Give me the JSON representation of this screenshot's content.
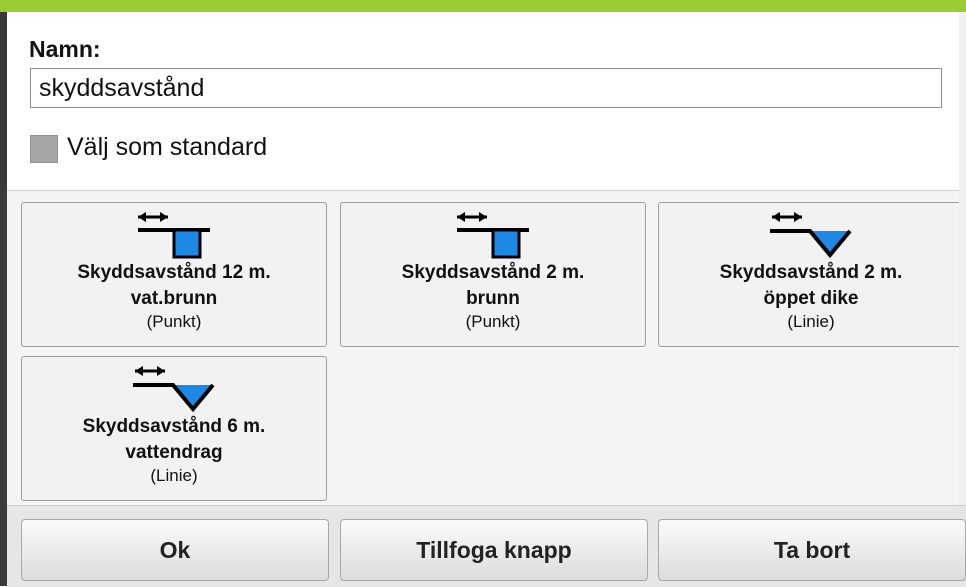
{
  "form": {
    "name_label": "Namn:",
    "name_value": "skyddsavstånd",
    "default_checkbox_label": "Välj som standard",
    "default_checked": false
  },
  "tiles": [
    {
      "title_line1": "Skyddsavstånd 12 m.",
      "title_line2": "vat.brunn",
      "type": "(Punkt)",
      "icon": "well-distance-icon"
    },
    {
      "title_line1": "Skyddsavstånd 2 m.",
      "title_line2": "brunn",
      "type": "(Punkt)",
      "icon": "well-distance-icon"
    },
    {
      "title_line1": "Skyddsavstånd 2 m.",
      "title_line2": "öppet dike",
      "type": "(Linie)",
      "icon": "ditch-distance-icon"
    },
    {
      "title_line1": "Skyddsavstånd 6 m.",
      "title_line2": "vattendrag",
      "type": "(Linie)",
      "icon": "ditch-distance-icon"
    }
  ],
  "buttons": {
    "ok": "Ok",
    "add": "Tillfoga knapp",
    "delete": "Ta bort"
  },
  "colors": {
    "accent": "#9acd32",
    "water": "#1e88e5"
  }
}
